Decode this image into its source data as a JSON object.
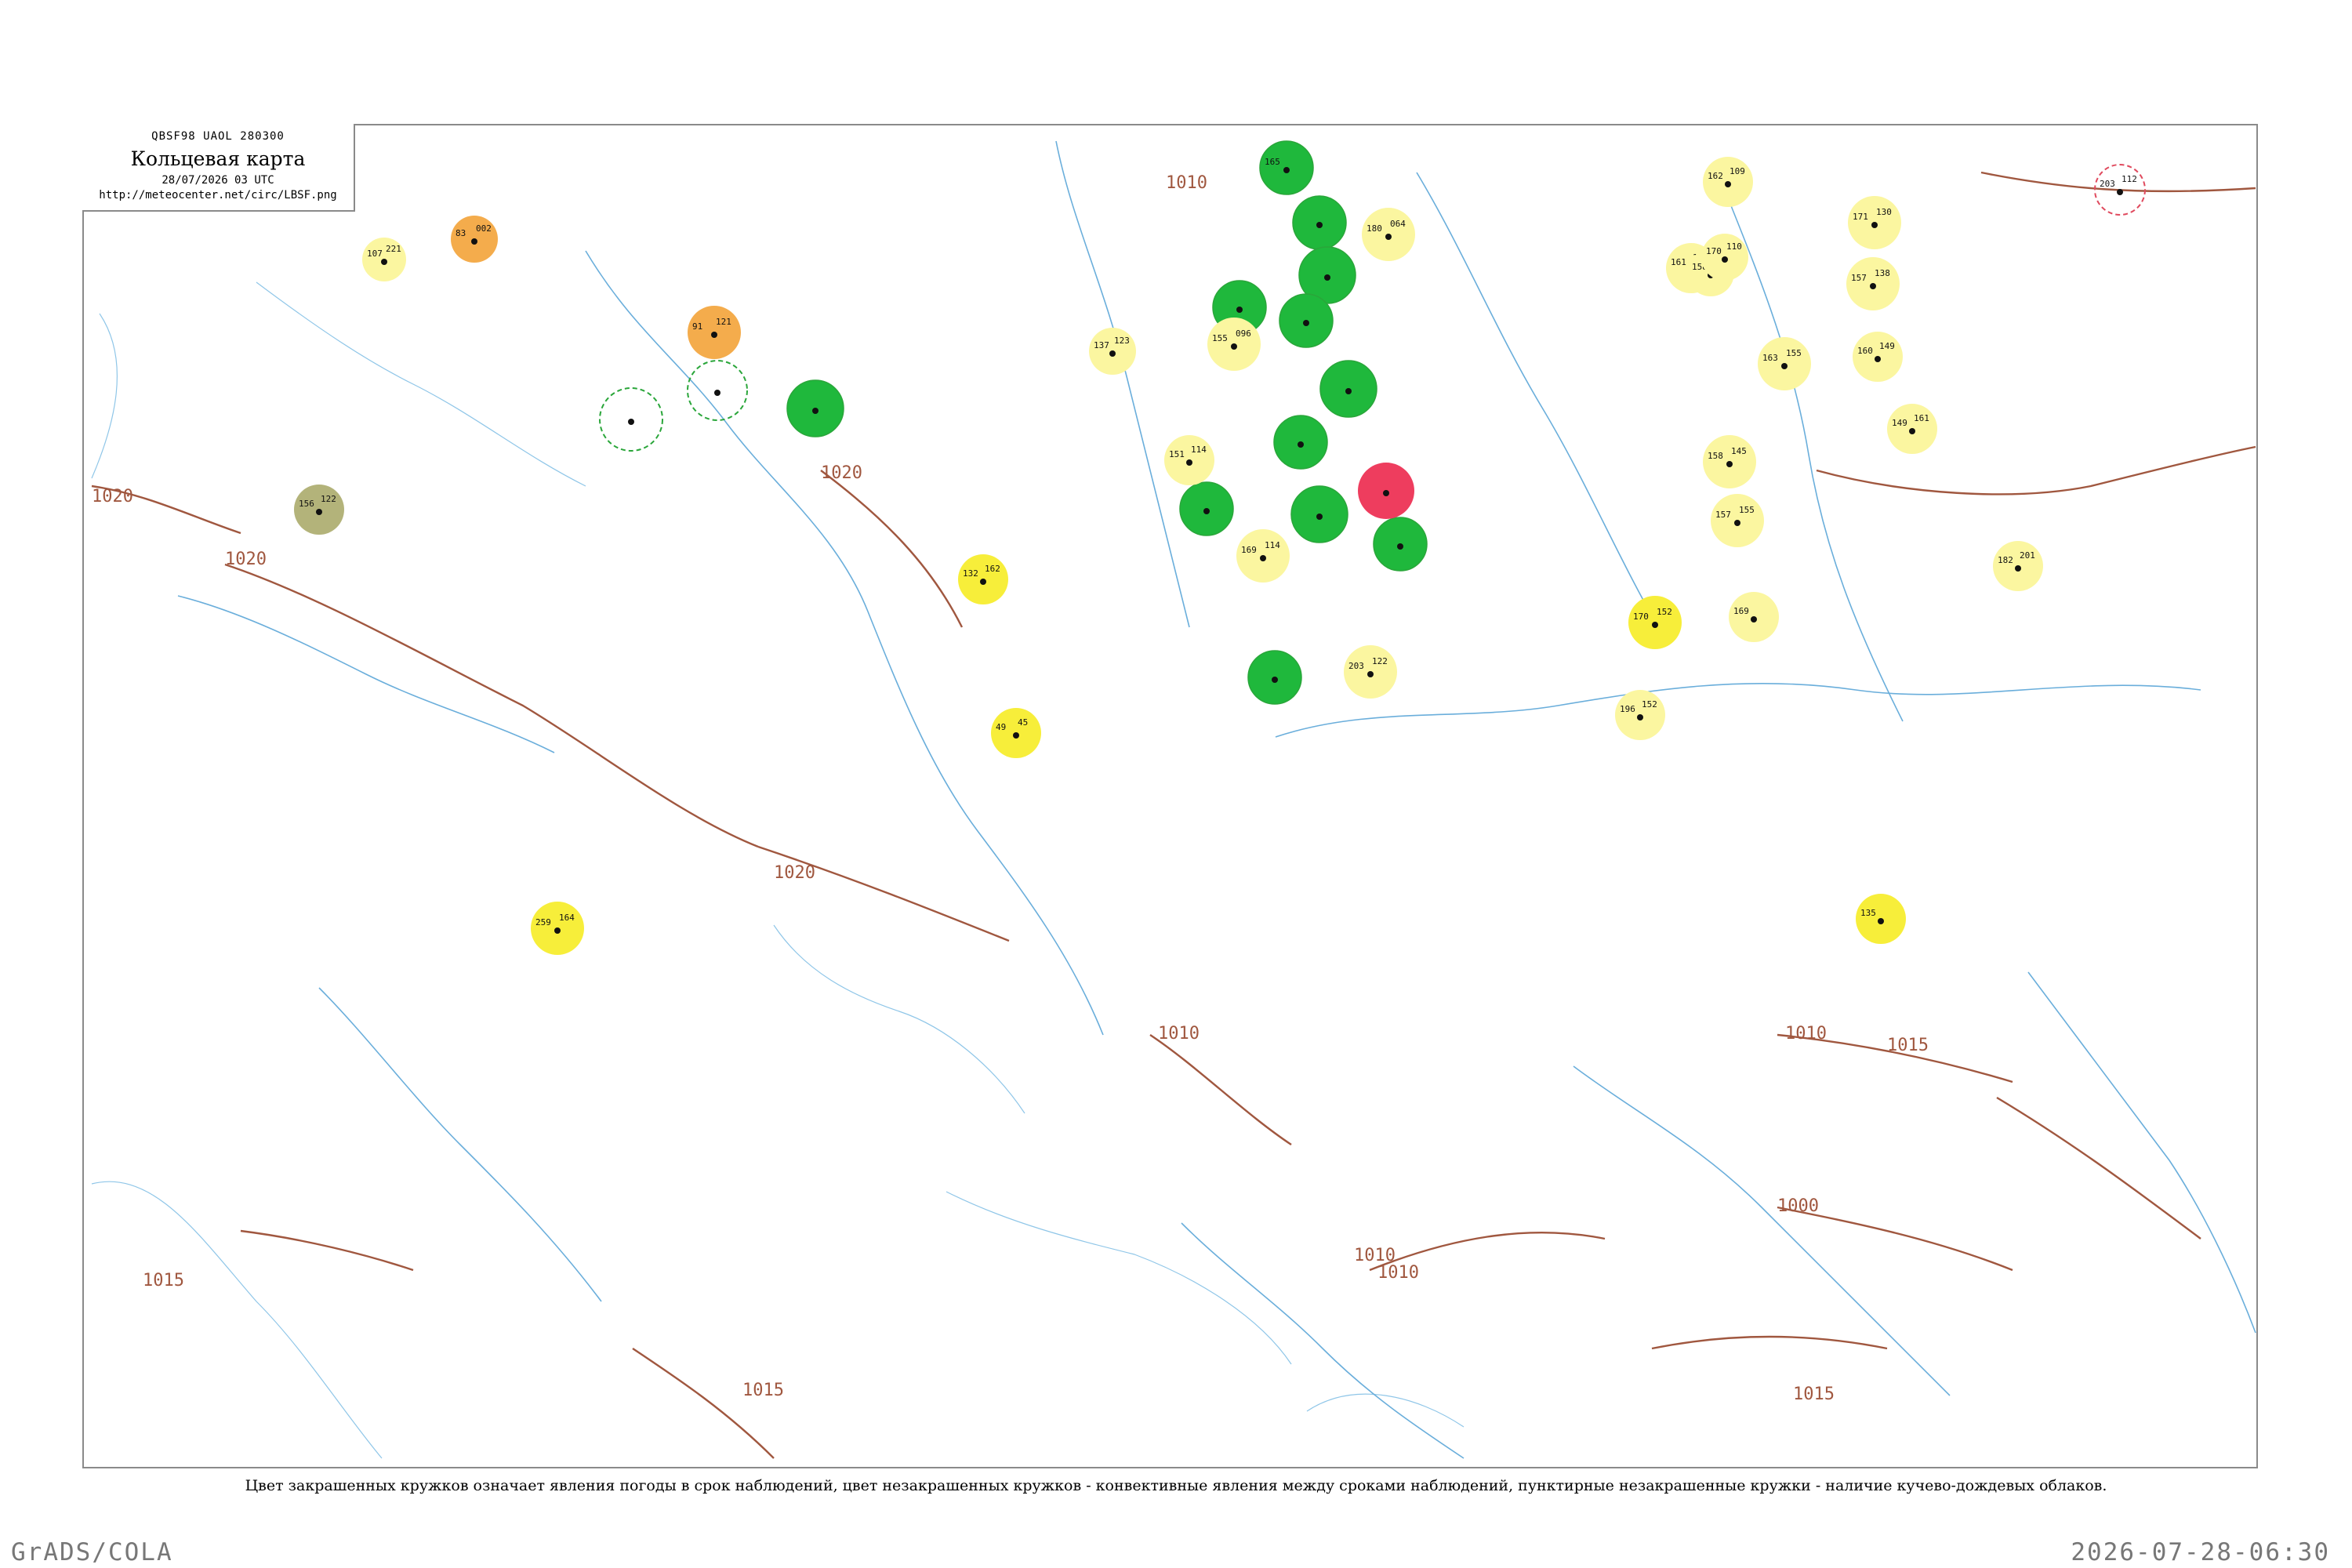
{
  "header": {
    "bulletin": "QBSF98  UAOL  280300",
    "title": "Кольцевая карта",
    "datetime": "28/07/2026 03 UTC",
    "url": "http://meteocenter.net/circ/LBSF.png"
  },
  "footer": {
    "caption": "Цвет закрашенных кружков означает явления погоды в срок наблюдений, цвет незакрашенных кружков - конвективные явления между сроками наблюдений, пунктирные незакрашенные кружки - наличие кучево-дождевых облаков.",
    "software": "GrADS/COLA",
    "timestamp": "2026-07-28-06:30"
  },
  "colors": {
    "isobar": "#a0573f",
    "river": "#6aaedb",
    "frame": "#8a8a8a",
    "green": "#1fb83c",
    "yellow": "#f7ee3a",
    "light_yellow": "#fbf6a0",
    "orange": "#f4ac4c",
    "red": "#ee3d5e",
    "olive": "#b3b37a",
    "green_outline": "#2aa63a",
    "red_outline": "#e04a5e"
  },
  "isobars": [
    {
      "label": "1010"
    },
    {
      "label": "1015"
    },
    {
      "label": "1020"
    },
    {
      "label": "1015"
    },
    {
      "label": "1020"
    },
    {
      "label": "1020"
    },
    {
      "label": "1020"
    },
    {
      "label": "1015"
    },
    {
      "label": "1010"
    },
    {
      "label": "1010"
    },
    {
      "label": "1010"
    },
    {
      "label": "1000"
    },
    {
      "label": "1015"
    },
    {
      "label": "1010"
    }
  ],
  "stations": [
    {
      "fill": "orange",
      "kind": "filled",
      "t": "83",
      "p": "002"
    },
    {
      "fill": "light_yellow",
      "kind": "filled",
      "t": "107",
      "p": "221"
    },
    {
      "fill": "orange",
      "kind": "filled",
      "t": "91",
      "p": "121"
    },
    {
      "fill": "olive",
      "kind": "filled",
      "t": "156",
      "p": "122"
    },
    {
      "fill": "green",
      "kind": "filled",
      "t": "",
      "p": ""
    },
    {
      "fill": "green_outline",
      "kind": "ring",
      "t": "",
      "p": ""
    },
    {
      "fill": "green_outline",
      "kind": "ring",
      "t": "",
      "p": ""
    },
    {
      "fill": "yellow",
      "kind": "filled",
      "t": "132",
      "p": "162"
    },
    {
      "fill": "yellow",
      "kind": "filled",
      "t": "49",
      "p": "45"
    },
    {
      "fill": "light_yellow",
      "kind": "filled",
      "t": "137",
      "p": "123"
    },
    {
      "fill": "green",
      "kind": "filled",
      "t": "165",
      "p": ""
    },
    {
      "fill": "green",
      "kind": "filled",
      "t": "",
      "p": ""
    },
    {
      "fill": "green",
      "kind": "filled",
      "t": "",
      "p": ""
    },
    {
      "fill": "green",
      "kind": "filled",
      "t": "",
      "p": ""
    },
    {
      "fill": "green",
      "kind": "filled",
      "t": "",
      "p": ""
    },
    {
      "fill": "green",
      "kind": "filled",
      "t": "",
      "p": ""
    },
    {
      "fill": "green",
      "kind": "filled",
      "t": "",
      "p": ""
    },
    {
      "fill": "green",
      "kind": "filled",
      "t": "",
      "p": ""
    },
    {
      "fill": "green",
      "kind": "filled",
      "t": "",
      "p": ""
    },
    {
      "fill": "green",
      "kind": "filled",
      "t": "",
      "p": ""
    },
    {
      "fill": "green",
      "kind": "filled",
      "t": "",
      "p": ""
    },
    {
      "fill": "red",
      "kind": "filled",
      "t": "",
      "p": ""
    },
    {
      "fill": "light_yellow",
      "kind": "filled",
      "t": "180",
      "p": "064"
    },
    {
      "fill": "light_yellow",
      "kind": "filled",
      "t": "155",
      "p": "096"
    },
    {
      "fill": "light_yellow",
      "kind": "filled",
      "t": "151",
      "p": "114"
    },
    {
      "fill": "light_yellow",
      "kind": "filled",
      "t": "169",
      "p": "114"
    },
    {
      "fill": "light_yellow",
      "kind": "filled",
      "t": "203",
      "p": "122"
    },
    {
      "fill": "light_yellow",
      "kind": "filled",
      "t": "162",
      "p": "109"
    },
    {
      "fill": "light_yellow",
      "kind": "filled",
      "t": "171",
      "p": "130"
    },
    {
      "fill": "light_yellow",
      "kind": "filled",
      "t": "157",
      "p": "138"
    },
    {
      "fill": "light_yellow",
      "kind": "filled",
      "t": "161",
      "p": "110"
    },
    {
      "fill": "light_yellow",
      "kind": "filled",
      "t": "158",
      "p": "155"
    },
    {
      "fill": "light_yellow",
      "kind": "filled",
      "t": "163",
      "p": "155"
    },
    {
      "fill": "light_yellow",
      "kind": "filled",
      "t": "160",
      "p": "149"
    },
    {
      "fill": "light_yellow",
      "kind": "filled",
      "t": "149",
      "p": "161"
    },
    {
      "fill": "light_yellow",
      "kind": "filled",
      "t": "158",
      "p": "145"
    },
    {
      "fill": "light_yellow",
      "kind": "filled",
      "t": "157",
      "p": "155"
    },
    {
      "fill": "light_yellow",
      "kind": "filled",
      "t": "182",
      "p": "201"
    },
    {
      "fill": "light_yellow",
      "kind": "filled",
      "t": "169",
      "p": ""
    },
    {
      "fill": "yellow",
      "kind": "filled",
      "t": "170",
      "p": "152"
    },
    {
      "fill": "light_yellow",
      "kind": "filled",
      "t": "196",
      "p": "152"
    },
    {
      "fill": "yellow",
      "kind": "filled",
      "t": "135",
      "p": ""
    },
    {
      "fill": "yellow",
      "kind": "filled",
      "t": "259",
      "p": "164"
    },
    {
      "fill": "light_yellow",
      "kind": "filled",
      "t": "170",
      "p": "110"
    },
    {
      "fill": "red_outline",
      "kind": "ring",
      "t": "203",
      "p": "112"
    }
  ]
}
